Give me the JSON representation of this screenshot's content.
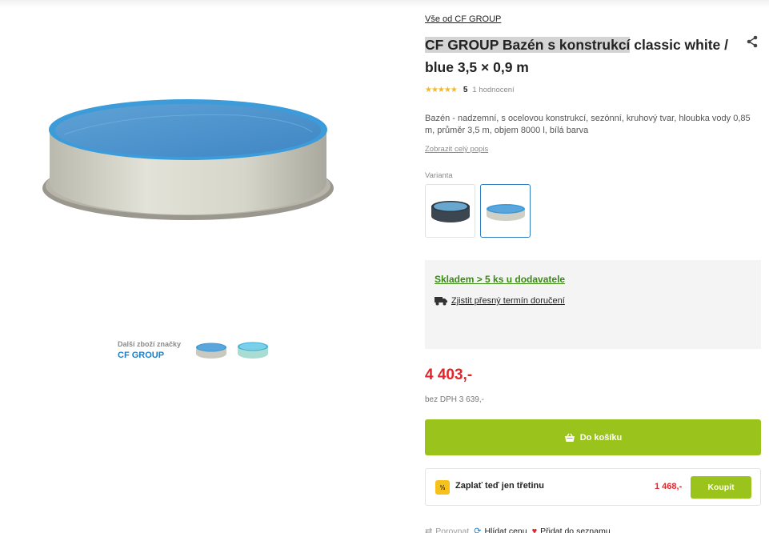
{
  "brand_all_link": "Vše od CF GROUP",
  "title": {
    "highlighted": "CF GROUP Bazén s konstrukcí",
    "rest": " classic white / blue 3,5 × 0,9 m"
  },
  "rating": {
    "stars": "★★★★★",
    "value": "5",
    "count": "1 hodnocení"
  },
  "description": "Bazén - nadzemní, s ocelovou konstrukcí, sezónní, kruhový tvar, hloubka vody 0,85 m, průměr 3,5 m, objem 8000 l, bílá barva",
  "show_more": "Zobrazit celý popis",
  "variant_label": "Varianta",
  "stock": "Skladem > 5 ks u dodavatele",
  "delivery_link": "Zjistit přesný termín doručení",
  "price": "4 403,-",
  "price_net": "bez DPH 3 639,-",
  "cart_button": "Do košíku",
  "installment": {
    "badge": "⅓",
    "text": "Zaplať teď jen třetinu",
    "price": "1 468,-",
    "button": "Koupit"
  },
  "gallery": {
    "brand_note": "Další zboží značky",
    "brand_name": "CF GROUP"
  },
  "bottom_actions": {
    "compare": "Porovnat",
    "watch": "Hlídat cenu",
    "wishlist": "Přidat do seznamu"
  },
  "colors": {
    "accent_green": "#9ac31c",
    "price_red": "#e0262b",
    "stock_green": "#3a8a12",
    "link_blue": "#1e7fc9"
  }
}
